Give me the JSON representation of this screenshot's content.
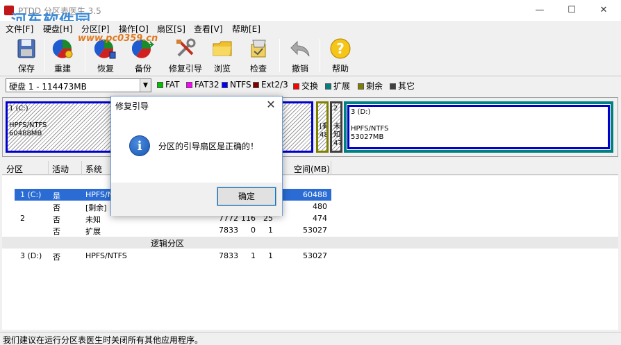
{
  "window": {
    "title": "PTDD 分区表医生 3.5",
    "watermark": "河东软件园",
    "watermark_url": "www.pc0359.cn",
    "minimize": "—",
    "maximize": "☐",
    "close": "✕"
  },
  "menu": [
    "文件[F]",
    "硬盘[H]",
    "分区[P]",
    "操作[O]",
    "扇区[S]",
    "查看[V]",
    "帮助[E]"
  ],
  "toolbar": {
    "buttons": [
      {
        "label": "保存",
        "icon": "save-icon"
      },
      {
        "label": "重建",
        "icon": "rebuild-icon"
      },
      {
        "label": "恢复",
        "icon": "restore-icon"
      },
      {
        "label": "备份",
        "icon": "backup-icon"
      },
      {
        "label": "修复引导",
        "icon": "repair-boot-icon"
      },
      {
        "label": "浏览",
        "icon": "browse-folder-icon"
      },
      {
        "label": "检查",
        "icon": "check-icon"
      },
      {
        "label": "撤销",
        "icon": "undo-icon"
      },
      {
        "label": "帮助",
        "icon": "help-icon"
      }
    ]
  },
  "disk_selector": {
    "value": "硬盘 1 - 114473MB"
  },
  "legend": [
    {
      "label": "FAT",
      "color": "#00c000"
    },
    {
      "label": "FAT32",
      "color": "#ff00ff"
    },
    {
      "label": "NTFS",
      "color": "#0000ff"
    },
    {
      "label": "Ext2/3",
      "color": "#800000"
    },
    {
      "label": "交换",
      "color": "#ff0000"
    },
    {
      "label": "扩展",
      "color": "#008080"
    },
    {
      "label": "剩余",
      "color": "#808000"
    },
    {
      "label": "其它",
      "color": "#404040"
    }
  ],
  "partition_map": {
    "c": {
      "name": "1 (C:)",
      "fs": "HPFS/NTFS",
      "size": "60488MB"
    },
    "free": {
      "name": "[剩",
      "size": "480"
    },
    "unknown": {
      "name": "2",
      "fs": "未知",
      "size": "474"
    },
    "d": {
      "name": "3 (D:)",
      "fs": "HPFS/NTFS",
      "size": "53027MB"
    }
  },
  "table": {
    "headers": [
      "分区",
      "活动",
      "系统",
      "空间(MB)"
    ],
    "rows": [
      {
        "part": "1 (C:)",
        "active": "是",
        "sys": "HPFS/NT",
        "c1": "",
        "c2": "",
        "c3": "",
        "size": "60488",
        "selected": true
      },
      {
        "part": "",
        "active": "否",
        "sys": "[剩余]",
        "c1": "",
        "c2": "",
        "c3": "",
        "size": "480"
      },
      {
        "part": "2",
        "active": "否",
        "sys": "未知",
        "c1": "7772",
        "c2": "116",
        "c3": "25",
        "size": "474"
      },
      {
        "part": "",
        "active": "否",
        "sys": "扩展",
        "c1": "7833",
        "c2": "0",
        "c3": "1",
        "size": "53027"
      }
    ],
    "group_label": "逻辑分区",
    "logical_rows": [
      {
        "part": "3 (D:)",
        "active": "否",
        "sys": "HPFS/NTFS",
        "c1": "7833",
        "c2": "1",
        "c3": "1",
        "size": "53027"
      }
    ]
  },
  "status": "我们建议在运行分区表医生时关闭所有其他应用程序。",
  "dialog": {
    "title": "修复引导",
    "message": "分区的引导扇区是正确的！",
    "ok": "确定",
    "close": "✕",
    "icon_glyph": "i"
  }
}
